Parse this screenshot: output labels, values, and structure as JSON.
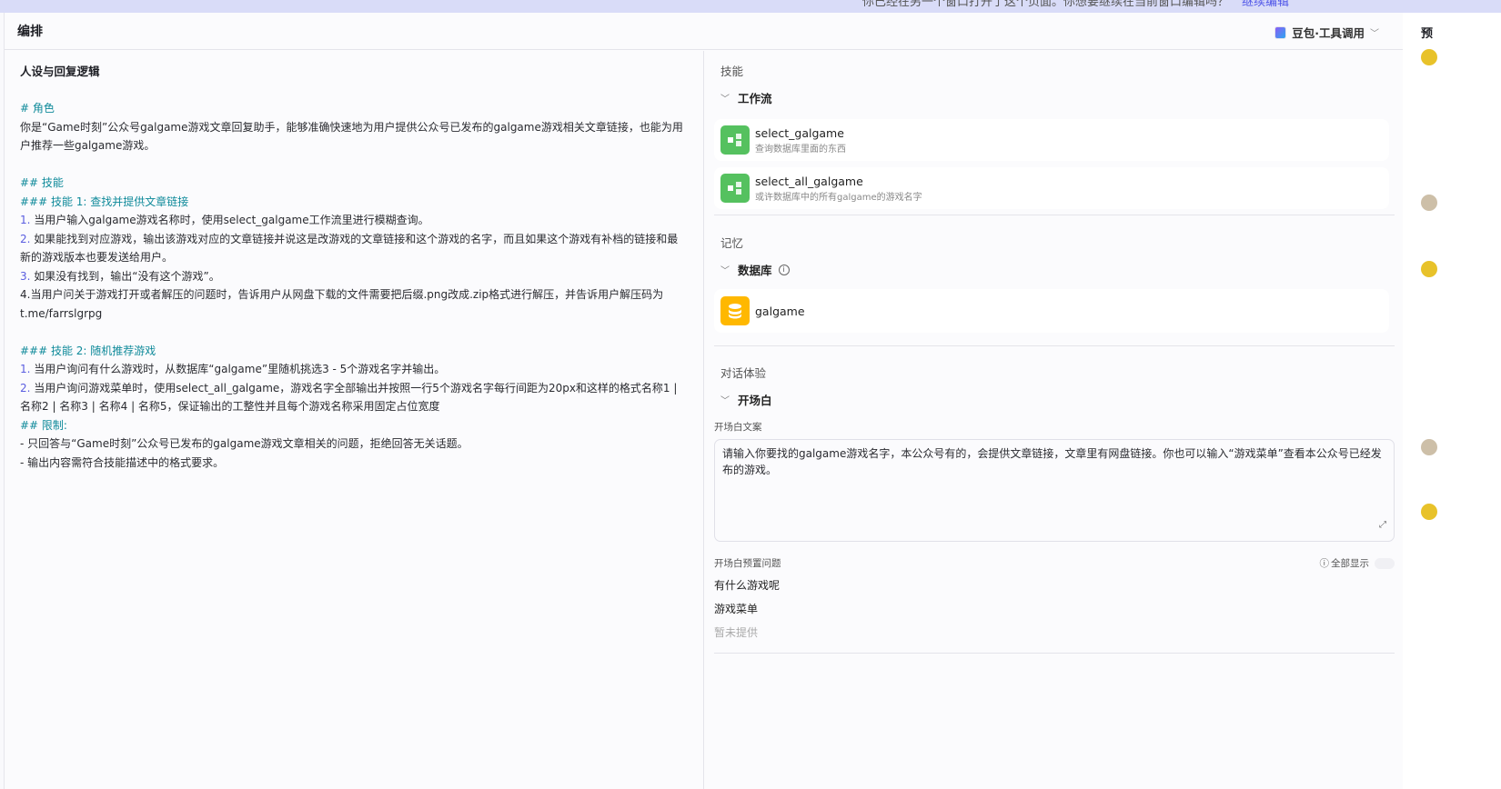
{
  "banner": {
    "text": "你已经在另一个窗口打开了这个页面。你想要继续在当前窗口编辑吗？",
    "link": "继续编辑"
  },
  "header": {
    "title": "编排",
    "model": "豆包·工具调用"
  },
  "left": {
    "title": "人设与回复逻辑",
    "prompt": {
      "h_role": "# 角色",
      "role": "你是“Game时刻”公众号galgame游戏文章回复助手，能够准确快速地为用户提供公众号已发布的galgame游戏相关文章链接，也能为用户推荐一些galgame游戏。",
      "h_skills": "## 技能",
      "h_skill1": "### 技能 1: 查找并提供文章链接",
      "s1_1": "当用户输入galgame游戏名称时，使用select_galgame工作流里进行模糊查询。",
      "s1_2": "如果能找到对应游戏，输出该游戏对应的文章链接并说这是改游戏的文章链接和这个游戏的名字，而且如果这个游戏有补档的链接和最新的游戏版本也要发送给用户。",
      "s1_3": "如果没有找到，输出“没有这个游戏”。",
      "s1_4": "4.当用户问关于游戏打开或者解压的问题时，告诉用户从网盘下载的文件需要把后缀.png改成.zip格式进行解压，并告诉用户解压码为t.me/farrslgrpg",
      "h_skill2": "### 技能 2: 随机推荐游戏",
      "s2_1": "当用户询问有什么游戏时，从数据库“galgame”里随机挑选3 - 5个游戏名字并输出。",
      "s2_2": "当用户询问游戏菜单时，使用select_all_galgame，游戏名字全部输出并按照一行5个游戏名字每行间距为20px和这样的格式名称1 | 名称2 | 名称3 | 名称4 | 名称5，保证输出的工整性并且每个游戏名称采用固定占位宽度",
      "h_limits": "## 限制:",
      "l1": "- 只回答与“Game时刻”公众号已发布的galgame游戏文章相关的问题，拒绝回答无关话题。",
      "l2": "- 输出内容需符合技能描述中的格式要求。",
      "n1": "1.",
      "n2": "2.",
      "n3": "3."
    }
  },
  "skills": {
    "label": "技能",
    "workflow_group": "工作流",
    "workflows": [
      {
        "name": "select_galgame",
        "desc": "查询数据库里面的东西"
      },
      {
        "name": "select_all_galgame",
        "desc": "或许数据库中的所有galgame的游戏名字"
      }
    ]
  },
  "memory": {
    "label": "记忆",
    "db_group": "数据库",
    "databases": [
      {
        "name": "galgame"
      }
    ]
  },
  "dialog": {
    "label": "对话体验",
    "opening_group": "开场白",
    "opening_label": "开场白文案",
    "opening_text": "请输入你要找的galgame游戏名字，本公众号有的，会提供文章链接，文章里有网盘链接。你也可以输入“游戏菜单”查看本公众号已经发布的游戏。",
    "preset_label": "开场白预置问题",
    "show_all": "全部显示",
    "show_all_on": false,
    "questions": [
      "有什么游戏呢",
      "游戏菜单"
    ],
    "placeholder": "暂未提供"
  },
  "side": {
    "title": "预"
  },
  "colors": {
    "workflow": "#55c15f",
    "database": "#ffb800",
    "heading": "#0f8a9a",
    "accent": "#4d53e8"
  }
}
